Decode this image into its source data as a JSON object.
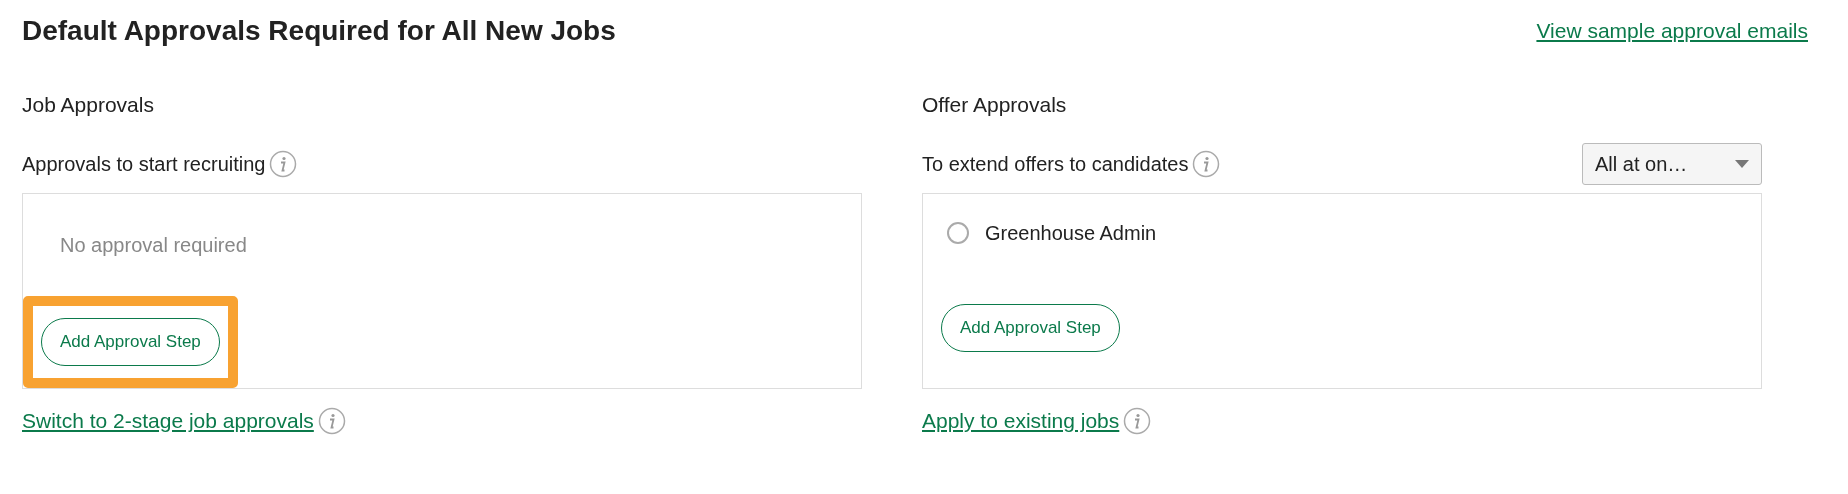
{
  "header": {
    "title": "Default Approvals Required for All New Jobs",
    "link": "View sample approval emails"
  },
  "job_approvals": {
    "heading": "Job Approvals",
    "subtitle": "Approvals to start recruiting",
    "empty_text": "No approval required",
    "button": "Add Approval Step",
    "highlighted": true,
    "footer_link": "Switch to 2-stage job approvals"
  },
  "offer_approvals": {
    "heading": "Offer Approvals",
    "subtitle": "To extend offers to candidates",
    "dropdown": "All at on…",
    "approvers": [
      {
        "name": "Greenhouse Admin",
        "selected": false
      }
    ],
    "button": "Add Approval Step",
    "footer_link": "Apply to existing jobs"
  }
}
